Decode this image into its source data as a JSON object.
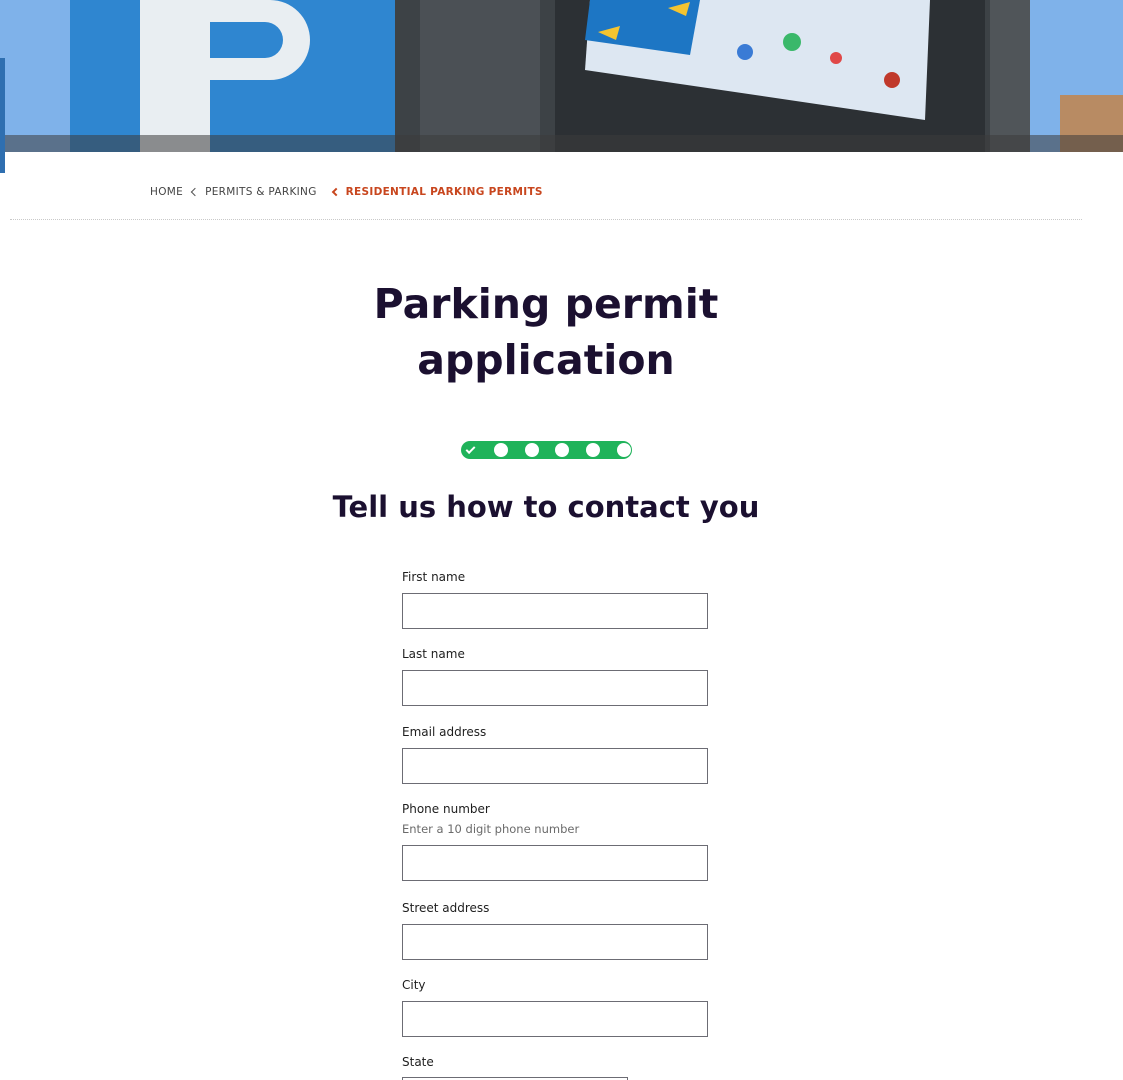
{
  "breadcrumb": {
    "items": [
      "HOME",
      "PERMITS & PARKING"
    ],
    "active": "RESIDENTIAL PARKING PERMITS"
  },
  "title": "Parking permit application",
  "progress": {
    "total_steps": 6,
    "completed_steps": 1,
    "accent_color": "#1fb35a"
  },
  "section_title": "Tell us how to contact you",
  "form": {
    "first_name": {
      "label": "First name",
      "value": ""
    },
    "last_name": {
      "label": "Last name",
      "value": ""
    },
    "email": {
      "label": "Email address",
      "value": ""
    },
    "phone": {
      "label": "Phone number",
      "hint": "Enter a 10 digit phone number",
      "value": ""
    },
    "street": {
      "label": "Street address",
      "value": ""
    },
    "city": {
      "label": "City",
      "value": ""
    },
    "state": {
      "label": "State",
      "value": ""
    }
  },
  "colors": {
    "heading": "#1b1030",
    "breadcrumb_active": "#c8461e"
  }
}
